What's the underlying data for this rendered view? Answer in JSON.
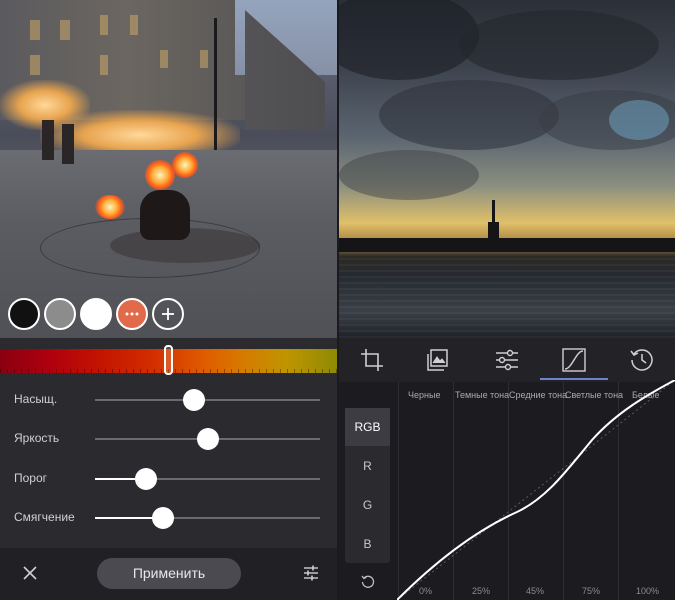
{
  "left_panel": {
    "color_swatches": [
      {
        "name": "black",
        "color": "#111111"
      },
      {
        "name": "gray",
        "color": "#8c8c8c"
      },
      {
        "name": "white",
        "color": "#ffffff"
      },
      {
        "name": "orange-more",
        "color": "#e06a4a",
        "icon": "more-dots-icon"
      },
      {
        "name": "add",
        "icon": "plus-icon"
      }
    ],
    "hue": {
      "position": 0.5
    },
    "sliders": [
      {
        "label": "Насыщ.",
        "value": 0.44
      },
      {
        "label": "Яркость",
        "value": 0.5
      },
      {
        "label": "Порог",
        "value": 0.23
      },
      {
        "label": "Смягчение",
        "value": 0.3
      }
    ],
    "bottom_bar": {
      "close_icon": "close-icon",
      "apply_label": "Применить",
      "adjust_icon": "sliders-icon"
    }
  },
  "right_panel": {
    "toolbar": [
      {
        "name": "crop",
        "icon": "crop-icon"
      },
      {
        "name": "layers",
        "icon": "layers-image-icon"
      },
      {
        "name": "adjust",
        "icon": "sliders-icon"
      },
      {
        "name": "curves",
        "icon": "curve-icon",
        "active": true
      },
      {
        "name": "history",
        "icon": "history-icon"
      }
    ],
    "channels": [
      "RGB",
      "R",
      "G",
      "B"
    ],
    "active_channel": "RGB",
    "column_labels": [
      "Черные",
      "Темные тона",
      "Средние тона",
      "Светлые тона",
      "Белые"
    ],
    "percent_labels": [
      "0%",
      "25%",
      "45%",
      "75%",
      "100%"
    ],
    "reset_icon": "reset-icon",
    "accent_color": "#6d83c9"
  }
}
